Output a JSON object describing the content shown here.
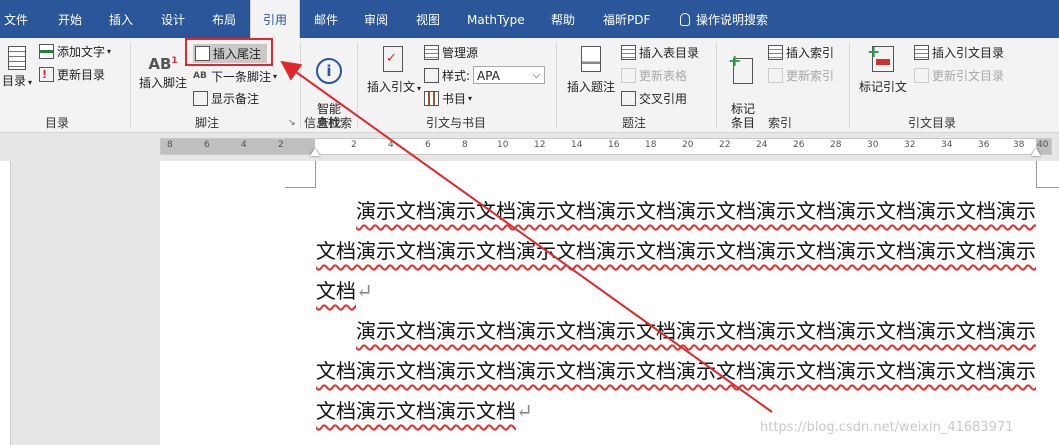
{
  "tabs": [
    "文件",
    "开始",
    "插入",
    "设计",
    "布局",
    "引用",
    "邮件",
    "审阅",
    "视图",
    "MathType",
    "帮助",
    "福昕PDF",
    "操作说明搜索"
  ],
  "active_tab": "引用",
  "ribbon": {
    "toc": {
      "big": "目录",
      "add_text": "添加文字",
      "update": "更新目录",
      "group": "目录"
    },
    "footnote": {
      "insert_footnote": "插入脚注",
      "ab_icon": "AB",
      "superscript": "1",
      "insert_endnote": "插入尾注",
      "next_footnote": "下一条脚注",
      "show_notes": "显示备注",
      "group": "脚注"
    },
    "research": {
      "smart_lookup": "智能\n查找",
      "group": "信息检索"
    },
    "citations": {
      "insert_citation": "插入引文",
      "manage_sources": "管理源",
      "style_label": "样式:",
      "style_value": "APA",
      "bibliography": "书目",
      "group": "引文与书目"
    },
    "captions": {
      "insert_caption": "插入题注",
      "insert_table_of_figures": "插入表目录",
      "update_table": "更新表格",
      "cross_ref": "交叉引用",
      "group": "题注"
    },
    "index": {
      "mark_entry": "标记\n条目",
      "insert_index": "插入索引",
      "update_index": "更新索引",
      "group": "索引"
    },
    "toa": {
      "mark_citation": "标记引文",
      "insert_toa": "插入引文目录",
      "update_toa": "更新引文目录",
      "group": "引文目录"
    }
  },
  "ruler_numbers": [
    "8",
    "6",
    "4",
    "2",
    "2",
    "4",
    "6",
    "8",
    "10",
    "12",
    "14",
    "16",
    "18",
    "20",
    "22",
    "24",
    "26",
    "28",
    "30",
    "32",
    "34",
    "36",
    "38",
    "40"
  ],
  "document": {
    "paragraph1": "演示文档演示文档演示文档演示文档演示文档演示文档演示文档演示文档演示文档演示文档演示文档演示文档演示文档演示文档演示文档演示文档演示文档演示文档",
    "paragraph2": "演示文档演示文档演示文档演示文档演示文档演示文档演示文档演示文档演示文档演示文档演示文档演示文档演示文档演示文档演示文档演示文档演示文档演示文档演示文档演示文档",
    "para_mark": "↵"
  },
  "watermark": "https://blog.csdn.net/weixin_41683971",
  "colors": {
    "tab_bar": "#2b579a",
    "ribbon": "#f3f3f3",
    "highlight": "#e0282a",
    "spell_underline": "#e03030"
  }
}
